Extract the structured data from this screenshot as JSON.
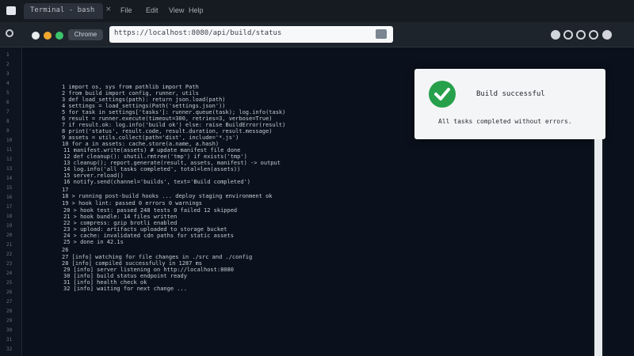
{
  "titlebar": {
    "tab_label": "Terminal - bash",
    "menu": [
      "File",
      "Edit",
      "View",
      "Help"
    ]
  },
  "toolbar": {
    "brand": "Chrome",
    "address": "https://localhost:8080/api/build/status"
  },
  "gutter": [
    "1",
    "2",
    "3",
    "4",
    "5",
    "6",
    "7",
    "8",
    "9",
    "10",
    "11",
    "12",
    "13",
    "14",
    "15",
    "16",
    "17",
    "18",
    "19",
    "20",
    "21",
    "22",
    "23",
    "24",
    "25",
    "26",
    "27",
    "28",
    "29",
    "30",
    "31",
    "32"
  ],
  "code": [
    "1 import os, sys from pathlib import Path",
    "2 from build import config, runner, utils",
    "3 def load_settings(path): return json.load(path)",
    "4 settings = load_settings(Path('settings.json'))",
    "5 for task in settings['tasks']: runner.queue(task); log.info(task)",
    "6 result = runner.execute(timeout=300, retries=3, verbose=True)",
    "7 if result.ok: log.info('build ok') else: raise BuildError(result)",
    "8 print('status', result.code, result.duration, result.message)",
    "9 assets = utils.collect(path='dist', include='*.js')",
    "10 for a in assets: cache.store(a.name, a.hash)",
    "11 manifest.write(assets) # update manifest file done",
    "12 def cleanup(): shutil.rmtree('tmp') if exists('tmp')",
    "13 cleanup(); report.generate(result, assets, manifest) -> output",
    "14 log.info('all tasks completed', total=len(assets))",
    "15 server.reload()",
    "16 notify.send(channel='builds', text='Build completed')",
    "17 ",
    "18 > running post-build hooks ... deploy staging environment ok",
    "19 > hook lint: passed 0 errors 0 warnings",
    "20 > hook test: passed 248 tests 0 failed 12 skipped",
    "21 > hook bundle: 14 files written",
    "22 > compress: gzip brotli enabled",
    "23 > upload: artifacts uploaded to storage bucket",
    "24 > cache: invalidated cdn paths for static assets",
    "25 > done in 42.1s",
    "26 ",
    "27 [info] watching for file changes in ./src and ./config",
    "28 [info] compiled successfully in 1287 ms",
    "29 [info] server listening on http://localhost:8080",
    "30 [info] build status endpoint ready",
    "31 [info] health check ok",
    "32 [info] waiting for next change ..."
  ],
  "popup": {
    "title": "Build successful",
    "message": "All tasks completed without errors."
  },
  "colors": {
    "accent_green": "#27a04b",
    "background": "#0a111c",
    "traffic_red": "#e8ecef",
    "traffic_yellow": "#f0a830",
    "traffic_green": "#3cc46a"
  },
  "icons": {
    "app": "folder-icon",
    "popup": "checkmark-circle-icon"
  }
}
